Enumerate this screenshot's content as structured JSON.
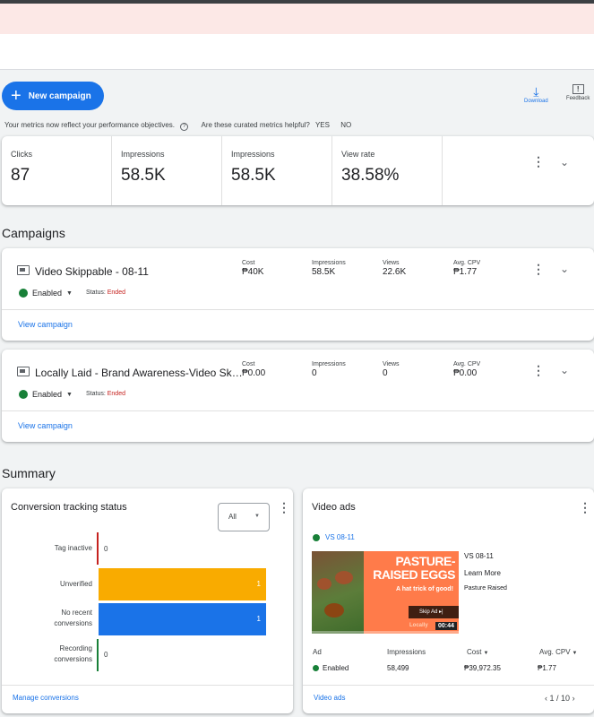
{
  "toolbar": {
    "new_campaign": "New campaign",
    "download": "Download",
    "feedback": "Feedback"
  },
  "metrics_note": {
    "text": "Your metrics now reflect your performance objectives.",
    "question": "Are these curated metrics helpful?",
    "yes": "YES",
    "no": "NO"
  },
  "metrics": [
    {
      "label": "Clicks",
      "value": "87"
    },
    {
      "label": "Impressions",
      "value": "58.5K"
    },
    {
      "label": "Impressions",
      "value": "58.5K"
    },
    {
      "label": "View rate",
      "value": "38.58%"
    }
  ],
  "campaigns_title": "Campaigns",
  "campaigns": [
    {
      "name": "Video Skippable - 08-11",
      "state": "Enabled",
      "status_label": "Status:",
      "status_value": "Ended",
      "stats": [
        {
          "label": "Cost",
          "value": "₱40K"
        },
        {
          "label": "Impressions",
          "value": "58.5K"
        },
        {
          "label": "Views",
          "value": "22.6K"
        },
        {
          "label": "Avg. CPV",
          "value": "₱1.77"
        }
      ],
      "link": "View campaign"
    },
    {
      "name": "Locally Laid - Brand Awareness-Video Ski…",
      "state": "Enabled",
      "status_label": "Status:",
      "status_value": "Ended",
      "stats": [
        {
          "label": "Cost",
          "value": "₱0.00"
        },
        {
          "label": "Impressions",
          "value": "0"
        },
        {
          "label": "Views",
          "value": "0"
        },
        {
          "label": "Avg. CPV",
          "value": "₱0.00"
        }
      ],
      "link": "View campaign"
    }
  ],
  "summary_title": "Summary",
  "conversion": {
    "title": "Conversion tracking status",
    "filter": "All",
    "rows": [
      {
        "label_lines": [
          "Tag inactive"
        ],
        "value": "0",
        "color": "#c5221f"
      },
      {
        "label_lines": [
          "Unverified"
        ],
        "value": "1",
        "color": "#f9ab00"
      },
      {
        "label_lines": [
          "No recent",
          "conversions"
        ],
        "value": "1",
        "color": "#1a73e8"
      },
      {
        "label_lines": [
          "Recording",
          "conversions"
        ],
        "value": "0",
        "color": "#188038"
      }
    ],
    "link": "Manage conversions"
  },
  "video_ads": {
    "title": "Video ads",
    "ad_name": "VS 08-11",
    "thumb": {
      "title": "PASTURE-RAISED EGGS",
      "subtitle": "A hat trick of good!",
      "skip": "Skip Ad",
      "duration": "00:44",
      "logo": "Locally"
    },
    "info_title": "VS 08-11",
    "info_cta": "Learn More",
    "info_brand": "Pasture Raised",
    "columns": {
      "ad": "Ad",
      "impressions": "Impressions",
      "cost": "Cost",
      "cpv": "Avg. CPV"
    },
    "row": {
      "status": "Enabled",
      "impressions": "58,499",
      "cost": "₱39,972.35",
      "cpv": "₱1.77"
    },
    "link": "Video ads",
    "pager": "1 / 10"
  }
}
